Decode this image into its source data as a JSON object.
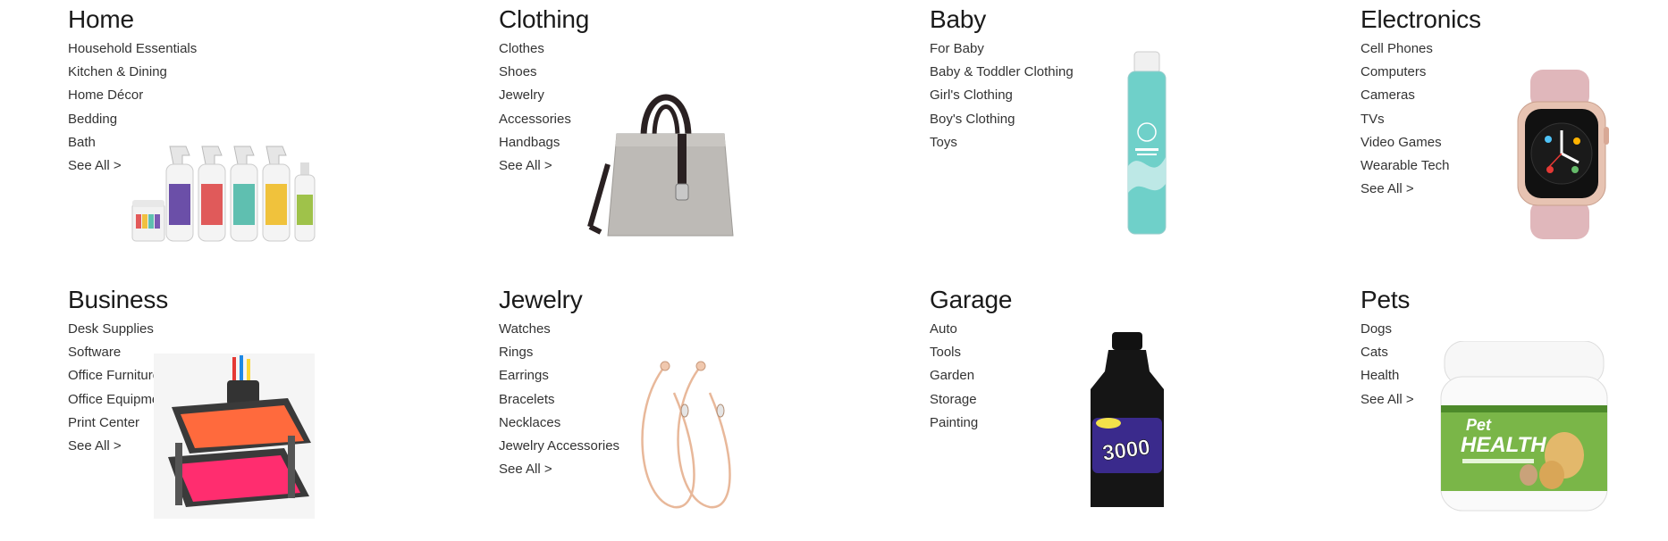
{
  "categories": [
    {
      "title": "Home",
      "links": [
        "Household Essentials",
        "Kitchen & Dining",
        "Home Décor",
        "Bedding",
        "Bath",
        "See All >"
      ],
      "image": "cleaning-spray-bottles-icon"
    },
    {
      "title": "Clothing",
      "links": [
        "Clothes",
        "Shoes",
        "Jewelry",
        "Accessories",
        "Handbags",
        "See All >"
      ],
      "image": "handbag-icon"
    },
    {
      "title": "Baby",
      "links": [
        "For Baby",
        "Baby & Toddler Clothing",
        "Girl's Clothing",
        "Boy's Clothing",
        "Toys"
      ],
      "image": "baby-lotion-bottle-icon"
    },
    {
      "title": "Electronics",
      "links": [
        "Cell Phones",
        "Computers",
        "Cameras",
        "TVs",
        "Video Games",
        "Wearable Tech",
        "See All >"
      ],
      "image": "smartwatch-icon"
    },
    {
      "title": "Business",
      "links": [
        "Desk Supplies",
        "Software",
        "Office Furniture",
        "Office Equipment",
        "Print Center",
        "See All >"
      ],
      "image": "desk-tray-organizer-icon"
    },
    {
      "title": "Jewelry",
      "links": [
        "Watches",
        "Rings",
        "Earrings",
        "Bracelets",
        "Necklaces",
        "Jewelry Accessories",
        "See All >"
      ],
      "image": "hoop-earrings-icon"
    },
    {
      "title": "Garage",
      "links": [
        "Auto",
        "Tools",
        "Garden",
        "Storage",
        "Painting"
      ],
      "image": "fuel-additive-bottle-icon"
    },
    {
      "title": "Pets",
      "links": [
        "Dogs",
        "Cats",
        "Health",
        "See All >"
      ],
      "image": "pet-balm-jar-icon"
    }
  ],
  "product_labels": {
    "garage_product": "3000",
    "pets_brand": "Pet",
    "pets_product": "HEALTH"
  },
  "colors": {
    "heading": "#1a1a1a",
    "link": "#333333"
  }
}
